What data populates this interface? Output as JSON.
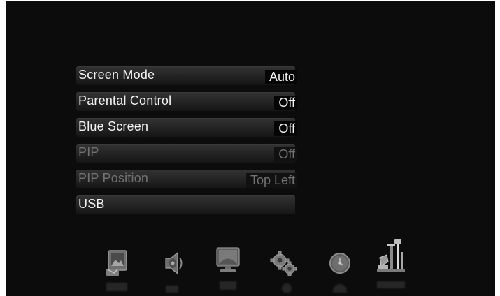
{
  "menu": {
    "items": [
      {
        "label": "Screen Mode",
        "value": "Auto",
        "enabled": true
      },
      {
        "label": "Parental Control",
        "value": "Off",
        "enabled": true
      },
      {
        "label": "Blue Screen",
        "value": "Off",
        "enabled": true
      },
      {
        "label": "PIP",
        "value": "Off",
        "enabled": false
      },
      {
        "label": "PIP Position",
        "value": "Top Left",
        "enabled": false
      },
      {
        "label": "USB",
        "value": "",
        "enabled": true
      }
    ]
  },
  "icon_bar": {
    "icons": [
      {
        "name": "picture-icon"
      },
      {
        "name": "speaker-icon"
      },
      {
        "name": "screen-icon"
      },
      {
        "name": "gear-icon"
      },
      {
        "name": "clock-icon"
      },
      {
        "name": "tools-icon"
      }
    ]
  },
  "colors": {
    "background": "#0c0c0c",
    "text": "#f2f2f2",
    "disabled_text": "#727272"
  }
}
